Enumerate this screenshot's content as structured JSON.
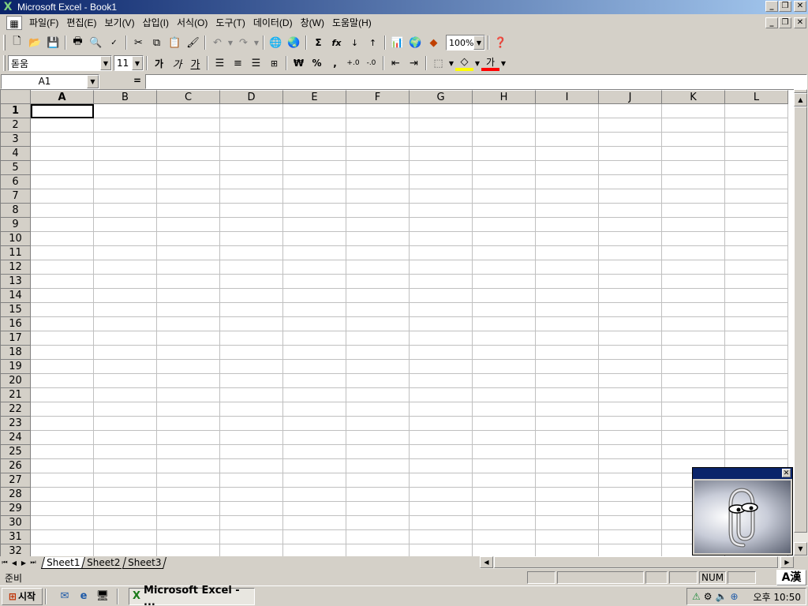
{
  "window": {
    "title": "Microsoft Excel - Book1",
    "app_icon": "excel-x-icon"
  },
  "menu": {
    "items": [
      "파일(F)",
      "편집(E)",
      "보기(V)",
      "삽입(I)",
      "서식(O)",
      "도구(T)",
      "데이터(D)",
      "창(W)",
      "도움말(H)"
    ]
  },
  "toolbar_standard": {
    "buttons": [
      "new-icon",
      "open-icon",
      "save-icon",
      "print-icon",
      "print-preview-icon",
      "spelling-icon",
      "cut-icon",
      "copy-icon",
      "paste-icon",
      "format-painter-icon",
      "undo-icon",
      "redo-icon",
      "hyperlink-icon",
      "web-toolbar-icon",
      "autosum-icon",
      "function-icon",
      "sort-ascending-icon",
      "sort-descending-icon",
      "chart-wizard-icon",
      "map-icon",
      "drawing-icon",
      "help-icon"
    ],
    "autosum_glyph": "Σ",
    "function_glyph": "fx",
    "zoom": "100%"
  },
  "toolbar_formatting": {
    "font_name": "돋움",
    "font_size": "11",
    "bold_label": "가",
    "italic_label": "가",
    "underline_label": "가",
    "currency_glyph": "₩",
    "percent_glyph": "%",
    "comma_glyph": ",",
    "font_color_label": "가",
    "colors": {
      "fill": "#ffff00",
      "font": "#ff0000"
    }
  },
  "formula_bar": {
    "name_box": "A1",
    "equals": "=",
    "value": ""
  },
  "grid": {
    "columns": [
      "A",
      "B",
      "C",
      "D",
      "E",
      "F",
      "G",
      "H",
      "I",
      "J",
      "K",
      "L"
    ],
    "rows": [
      "1",
      "2",
      "3",
      "4",
      "5",
      "6",
      "7",
      "8",
      "9",
      "10",
      "11",
      "12",
      "13",
      "14",
      "15",
      "16",
      "17",
      "18",
      "19",
      "20",
      "21",
      "22",
      "23",
      "24",
      "25",
      "26",
      "27",
      "28",
      "29",
      "30",
      "31",
      "32"
    ],
    "active_cell": "A1"
  },
  "sheets": {
    "tabs": [
      "Sheet1",
      "Sheet2",
      "Sheet3"
    ],
    "active": "Sheet1"
  },
  "status": {
    "text": "준비",
    "num": "NUM",
    "ime": "A漢"
  },
  "taskbar": {
    "start_label": "시작",
    "task_label": "Microsoft Excel - ...",
    "clock": "오후 10:50"
  }
}
